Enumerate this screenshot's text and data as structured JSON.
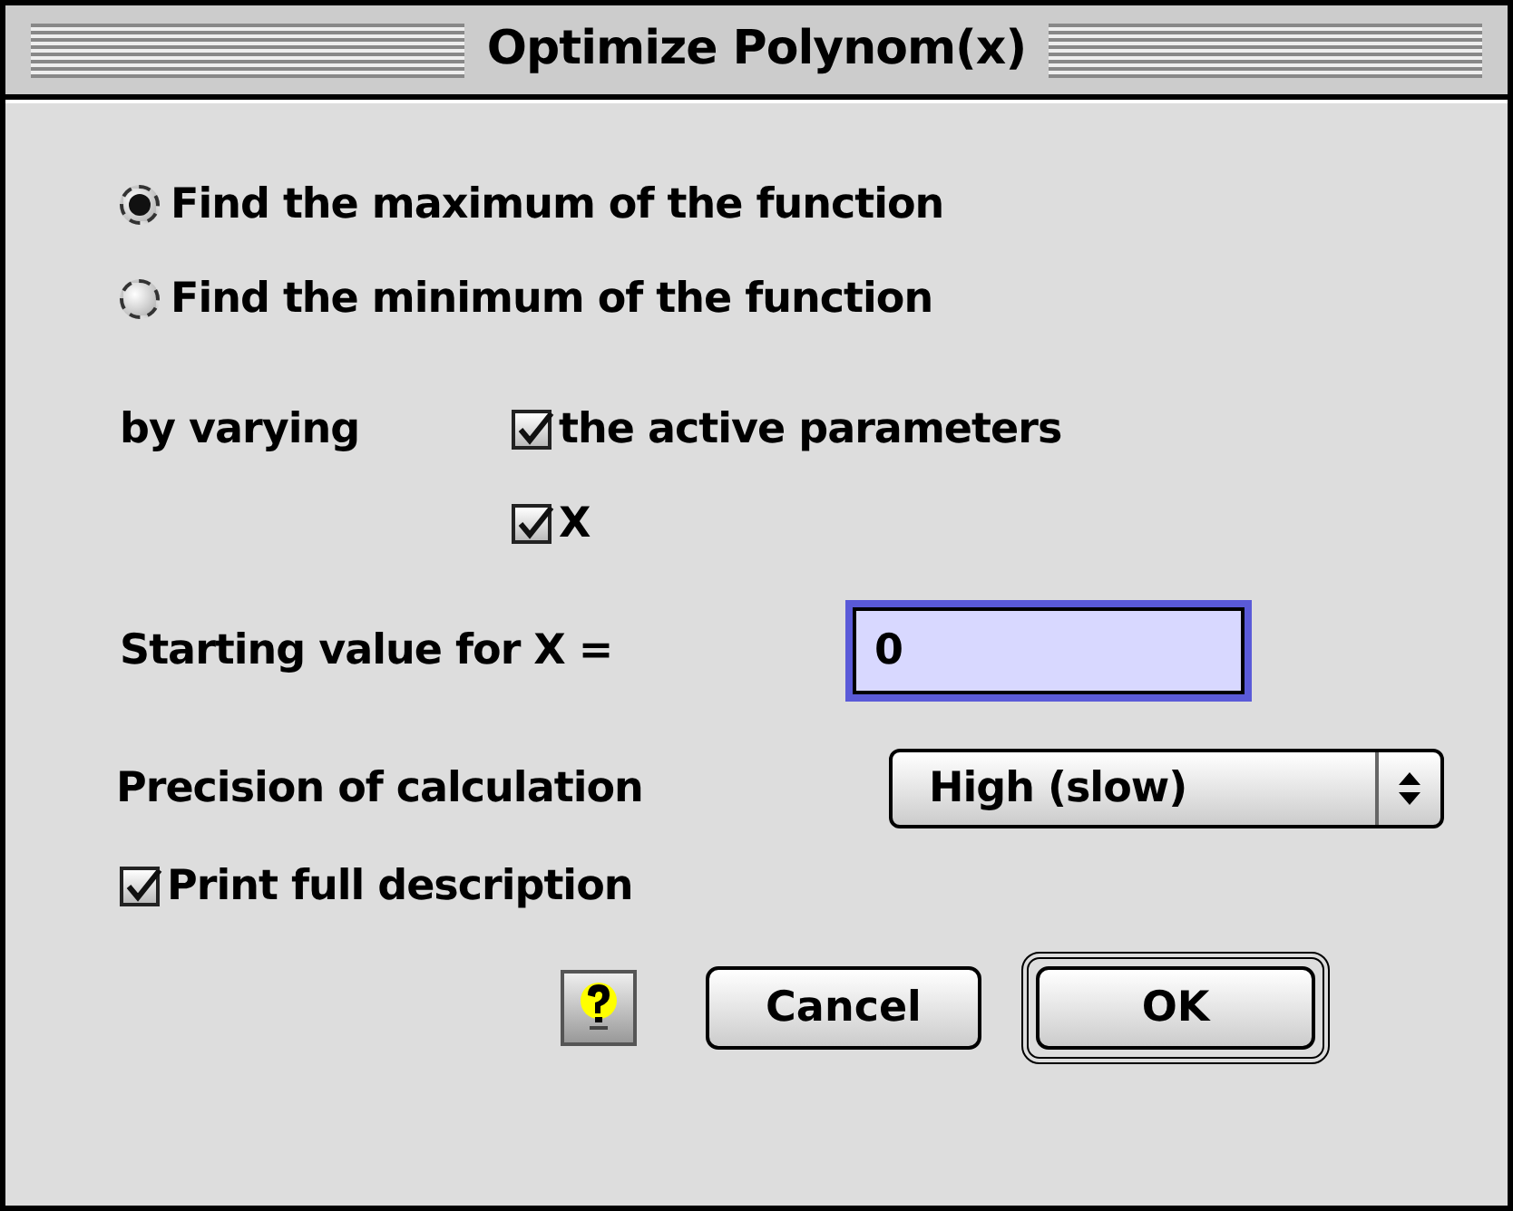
{
  "window": {
    "title": "Optimize Polynom(x)"
  },
  "objective": [
    {
      "label": "Find the maximum of the function",
      "selected": true
    },
    {
      "label": "Find the minimum of the function",
      "selected": false
    }
  ],
  "vary": {
    "label": "by varying",
    "options": [
      {
        "label": "the active parameters",
        "checked": true
      },
      {
        "label": "X",
        "checked": true
      }
    ]
  },
  "start": {
    "label": "Starting value for X =",
    "value": "0"
  },
  "precision": {
    "label": "Precision of calculation",
    "value": "High (slow)"
  },
  "print": {
    "label": "Print full description",
    "checked": true
  },
  "buttons": [
    {
      "label": "Cancel",
      "default": false
    },
    {
      "label": "OK",
      "default": true
    }
  ]
}
